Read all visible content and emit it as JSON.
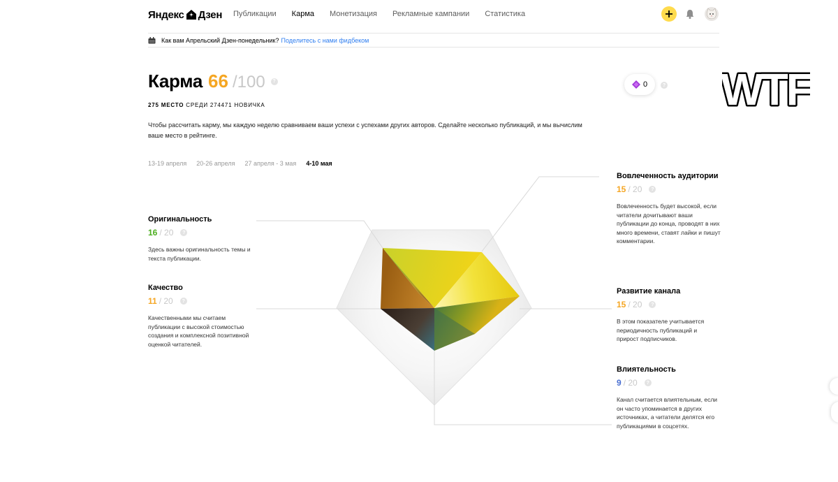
{
  "header": {
    "logo_left": "Яндекс",
    "logo_right": "Дзен",
    "nav": [
      {
        "label": "Публикации",
        "active": false
      },
      {
        "label": "Карма",
        "active": true
      },
      {
        "label": "Монетизация",
        "active": false
      },
      {
        "label": "Рекламные кампании",
        "active": false
      },
      {
        "label": "Статистика",
        "active": false
      }
    ],
    "plus_label": "+"
  },
  "notice": {
    "text": "Как вам Апрельский Дзен-понедельник?",
    "link": "Поделитесь с нами фидбеком"
  },
  "karma": {
    "label": "Карма",
    "score": "66",
    "max": "/100",
    "rank_place": "275 место",
    "rank_rest": "среди 274471 новичка",
    "intro": "Чтобы рассчитать карму, мы каждую неделю сравниваем ваши успехи с успехами других авторов. Сделайте несколько публикаций, и мы вычислим ваше место в рейтинге.",
    "help": "?"
  },
  "weeks": [
    {
      "label": "13-19 апреля",
      "active": false
    },
    {
      "label": "20-26 апреля",
      "active": false
    },
    {
      "label": "27 апреля - 3 мая",
      "active": false
    },
    {
      "label": "4-10 мая",
      "active": true
    }
  ],
  "gems": {
    "count": "0"
  },
  "overlay_text": "WTF",
  "metrics": {
    "originality": {
      "title": "Оригинальность",
      "value": "16",
      "max": "/ 20",
      "color": "#4cae1f",
      "desc": "Здесь важны оригинальность темы и текста публикации."
    },
    "quality": {
      "title": "Качество",
      "value": "11",
      "max": "/ 20",
      "color": "#f5a623",
      "desc": "Качественными мы считаем публикации с высокой стоимостью создания и комплексной позитивной оценкой читателей."
    },
    "engagement": {
      "title": "Вовлеченность аудитории",
      "value": "15",
      "max": "/ 20",
      "color": "#f5a623",
      "desc": "Вовлеченность будет высокой, если читатели дочитывают ваши публикации до конца, проводят в них много времени, ставят лайки и пишут комментарии."
    },
    "growth": {
      "title": "Развитие канала",
      "value": "15",
      "max": "/ 20",
      "color": "#f5a623",
      "desc": "В этом показателе учитывается периодичность публикаций и прирост подписчиков."
    },
    "influence": {
      "title": "Влиятельность",
      "value": "9",
      "max": "/ 20",
      "color": "#4a6fd1",
      "desc": "Канал считается влиятельным, если он часто упоминается в других источниках, а читатели делятся его публикациями в соцсетях."
    }
  }
}
